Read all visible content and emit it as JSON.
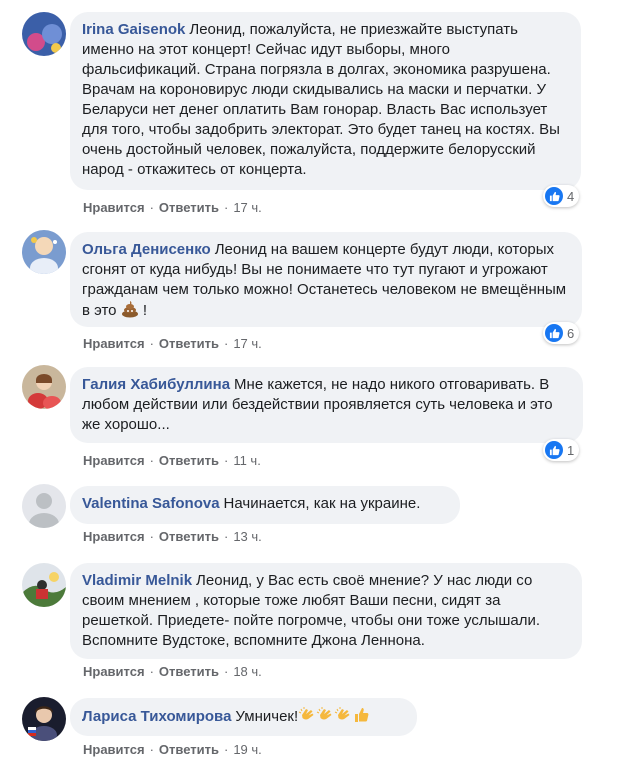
{
  "actions": {
    "like": "Нравится",
    "reply": "Ответить",
    "sep": "·"
  },
  "icons": {
    "like": "like-icon",
    "poop": "poop-emoji",
    "clap": "clap-emoji",
    "thumbs": "thumbs-up-emoji"
  },
  "colors": {
    "author": "#385898",
    "bubble": "#f0f2f5",
    "like_blue": "#1877f2"
  },
  "comments": [
    {
      "author": "Irina Gaisenok",
      "text": "Леонид, пожалуйста, не приезжайте выступать именно на этот концерт! Сейчас идут выборы, много фальсификаций. Страна погрязла в долгах, экономика разрушена. Врачам на короновирус люди скидывались на маски и перчатки. У Беларуси нет денег оплатить Вам гонорар. Власть Вас использует для того, чтобы задобрить электорат. Это будет танец на костях. Вы очень достойный человек, пожалуйста, поддержите белорусский народ - откажитесь от концерта.",
      "time": "17 ч.",
      "reactions": "4"
    },
    {
      "author": "Ольга Денисенко",
      "text": "Леонид на вашем концерте будут люди, которых сгонят от куда нибудь! Вы не понимаете что тут пугают и угрожают гражданам чем только можно! Останетесь человеком не вмещённым в это",
      "text_end": " !",
      "time": "17 ч.",
      "reactions": "6"
    },
    {
      "author": "Галия Хабибуллина",
      "text": "Мне кажется, не надо никого отговаривать. В любом действии или бездействии проявляется суть человека и это же хорошо...",
      "time": "11 ч.",
      "reactions": "1"
    },
    {
      "author": "Valentina Safonova",
      "text": "Начинается, как на украине.",
      "time": "13 ч."
    },
    {
      "author": "Vladimir Melnik",
      "text": "Леонид, у Вас есть своё мнение? У нас люди со своим мнением , которые тоже любят Ваши песни, сидят за решеткой. Приедете- пойте погромче, чтобы они тоже услышали. Вспомните Вудстоке, вспомните Джона Леннона.",
      "time": "18 ч."
    },
    {
      "author": "Лариса Тихомирова",
      "text": "Умничек!",
      "time": "19 ч."
    }
  ]
}
